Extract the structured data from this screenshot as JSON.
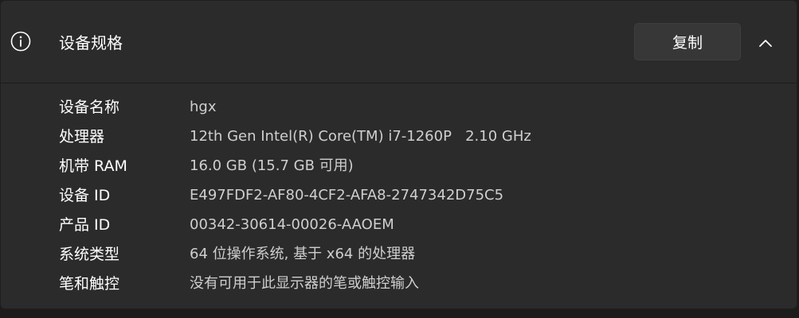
{
  "section": {
    "title": "设备规格",
    "copy_label": "复制",
    "icons": {
      "info": "info-circle-icon",
      "collapse": "chevron-up-icon"
    }
  },
  "specs": [
    {
      "label": "设备名称",
      "value": "hgx"
    },
    {
      "label": "处理器",
      "value": "12th Gen Intel(R) Core(TM) i7-1260P   2.10 GHz"
    },
    {
      "label": "机带 RAM",
      "value": "16.0 GB (15.7 GB 可用)"
    },
    {
      "label": "设备 ID",
      "value": "E497FDF2-AF80-4CF2-AFA8-2747342D75C5"
    },
    {
      "label": "产品 ID",
      "value": "00342-30614-00026-AAOEM"
    },
    {
      "label": "系统类型",
      "value": "64 位操作系统, 基于 x64 的处理器"
    },
    {
      "label": "笔和触控",
      "value": "没有可用于此显示器的笔或触控输入"
    }
  ]
}
